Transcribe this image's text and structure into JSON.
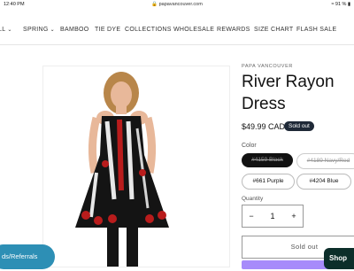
{
  "status_bar": {
    "time": "12:40 PM",
    "url": "papavancouver.com",
    "battery": "91 %"
  },
  "nav": {
    "items": [
      "LL",
      "SPRING",
      "BAMBOO",
      "TIE DYE",
      "COLLECTIONS",
      "WHOLESALE",
      "REWARDS",
      "SIZE CHART",
      "FLASH SALE"
    ]
  },
  "product": {
    "vendor": "PAPA VANCOUVER",
    "title": "River Rayon Dress",
    "price": "$49.99 CAD",
    "badge": "Sold out",
    "color_label": "Color",
    "color_options": [
      "#4159 Black",
      "#4189 Navy/Red",
      "#661 Purple",
      "#4204 Blue"
    ],
    "quantity_label": "Quantity",
    "quantity": "1",
    "sold_out_button": "Sold out"
  },
  "overlays": {
    "referral": "ds/Referrals",
    "chat": "Shop"
  },
  "colors": {
    "badge_bg": "#1f2937",
    "selected_pill": "#121212",
    "referral": "#2d8fb5",
    "chat": "#0c2e2a"
  }
}
